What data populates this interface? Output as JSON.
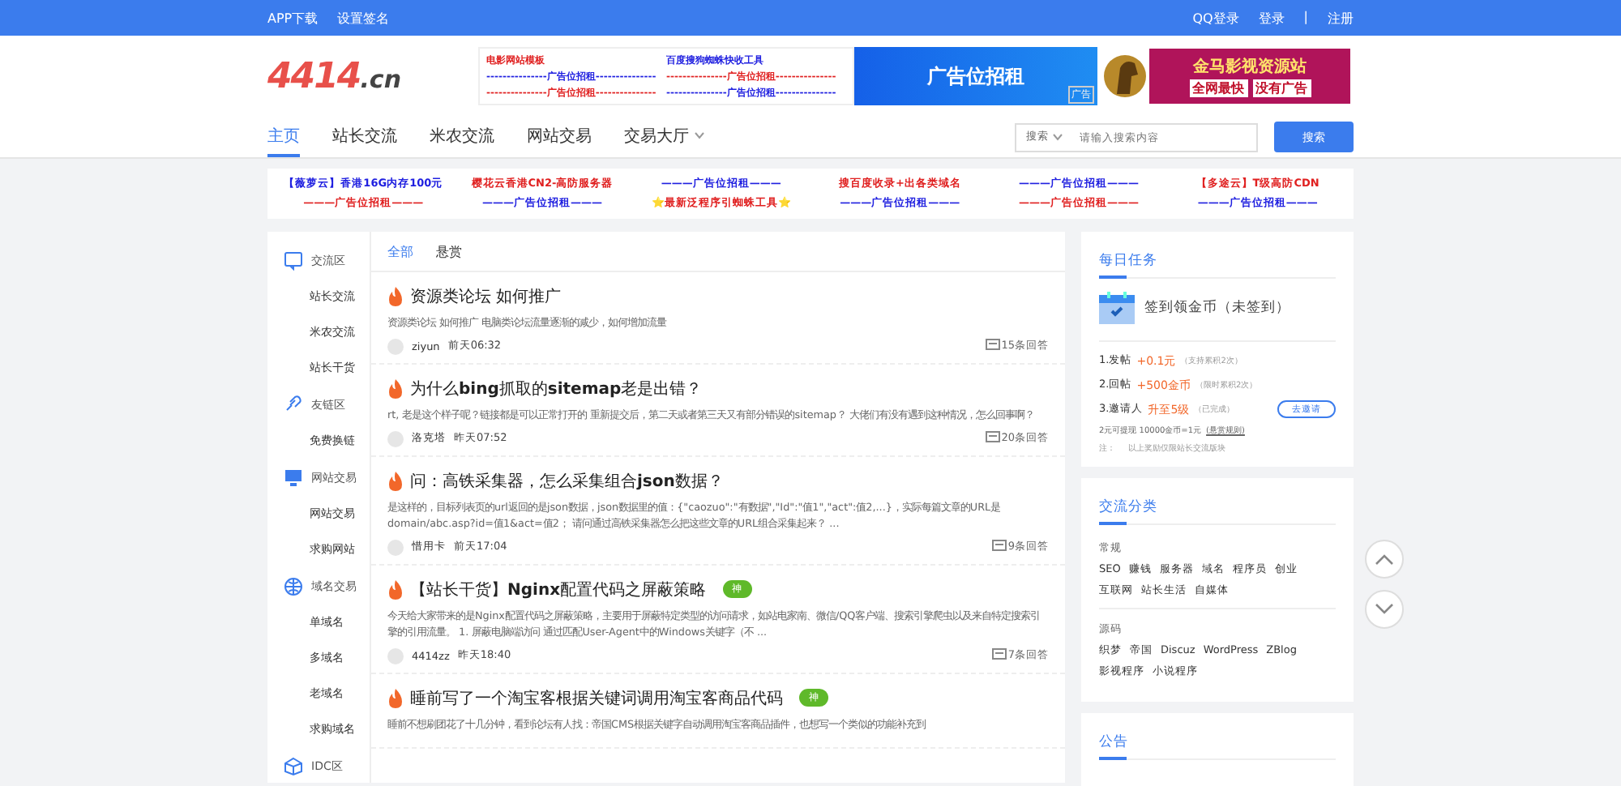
{
  "top_bar": {
    "left_links": [
      "APP下载",
      "设置签名"
    ],
    "right_links": [
      "QQ登录",
      "登录",
      "|",
      "注册"
    ]
  },
  "header": {
    "logo": {
      "main": "4414",
      "suffix": ".cn"
    },
    "text_ads": [
      {
        "text": "电影网站模板",
        "color": "#e02020"
      },
      {
        "text": "百度搜狗蜘蛛快收工具",
        "color": "#2020e0"
      },
      {
        "text": "---------------广告位招租---------------",
        "color": "#2020e0"
      },
      {
        "text": "---------------广告位招租---------------",
        "color": "#e02020"
      },
      {
        "text": "---------------广告位招租---------------",
        "color": "#e02020"
      },
      {
        "text": "---------------广告位招租---------------",
        "color": "#2020e0"
      }
    ],
    "banner_ad": "广告位招租",
    "banner_tag": "广告",
    "promo_ad": {
      "line1": "金马影视资源站",
      "line2": [
        "全网最快",
        "没有广告"
      ]
    }
  },
  "nav": {
    "items": [
      {
        "label": "主页",
        "selected": true,
        "dropdown": false
      },
      {
        "label": "站长交流",
        "selected": false,
        "dropdown": false
      },
      {
        "label": "米农交流",
        "selected": false,
        "dropdown": false
      },
      {
        "label": "网站交易",
        "selected": false,
        "dropdown": false
      },
      {
        "label": "交易大厅",
        "selected": false,
        "dropdown": true
      }
    ],
    "search": {
      "scope": "搜索",
      "placeholder": "请输入搜索内容",
      "button": "搜索"
    }
  },
  "ad_strip": [
    {
      "text": "【薇萝云】香港**16G**内存**100元**",
      "color": "#2020e0"
    },
    {
      "text": "樱花云香港**CN2**-高防服务器",
      "color": "#e02020"
    },
    {
      "text": "———广告位招租———",
      "color": "#2020e0"
    },
    {
      "text": "搜百度收录+出各类域名",
      "color": "#e02020"
    },
    {
      "text": "———广告位招租———",
      "color": "#2020e0"
    },
    {
      "text": "【多途云】**T级高防CDN**",
      "color": "#e02020"
    },
    {
      "text": "———广告位招租———",
      "color": "#e02020"
    },
    {
      "text": "———广告位招租———",
      "color": "#2020e0"
    },
    {
      "text": "⭐最新泛程序引蜘蛛工具⭐",
      "color": "#e02020"
    },
    {
      "text": "———广告位招租———",
      "color": "#2020e0"
    },
    {
      "text": "———广告位招租———",
      "color": "#e02020"
    },
    {
      "text": "———广告位招租———",
      "color": "#2020e0"
    }
  ],
  "sidebar": [
    {
      "label": "交流区",
      "kind": "chat",
      "children": [
        {
          "label": "站长交流"
        },
        {
          "label": "米农交流"
        },
        {
          "label": "站长干货"
        }
      ]
    },
    {
      "label": "友链区",
      "kind": "link",
      "children": [
        {
          "label": "免费换链"
        }
      ]
    },
    {
      "label": "网站交易",
      "kind": "monitor",
      "children": [
        {
          "label": "网站交易"
        },
        {
          "label": "求购网站"
        }
      ]
    },
    {
      "label": "域名交易",
      "kind": "globe",
      "children": [
        {
          "label": "单域名"
        },
        {
          "label": "多域名"
        },
        {
          "label": "老域名"
        },
        {
          "label": "求购域名"
        }
      ]
    },
    {
      "label": "IDC区",
      "kind": "cube"
    }
  ],
  "feed": {
    "tabs": [
      {
        "label": "全部",
        "selected": true
      },
      {
        "label": "悬赏",
        "selected": false
      }
    ],
    "posts": [
      {
        "title": "资源类论坛 如何推广",
        "summary": "资源类论坛 如何推广 电脑类论坛流量逐渐的减少，如何增加流量",
        "author": "ziyun",
        "time": "前天06:32",
        "replies": "15条回答"
      },
      {
        "title": "为什么**bing**抓取的**sitemap**老是出错？",
        "summary": "rt, 老是这个样子呢？链接都是可以正常打开的 重新提交后，第二天或者第三天又有部分错误的sitemap？ 大佬们有没有遇到这种情况，怎么回事啊？",
        "author": "洛克塔",
        "time": "昨天07:52",
        "replies": "20条回答"
      },
      {
        "title": "问：高铁采集器，怎么采集组合**json**数据？",
        "summary": "是这样的，目标列表页的url返回的是json数据，json数据里的值：{\"caozuo\":\"有数据\",\"Id\":\"值1\",\"act\":值2,...}，实际每篇文章的URL是 domain/abc.asp?id=值1&act=值2； 请问通过高铁采集器怎么把这些文章的URL组合采集起来？ ...",
        "author": "惜用卡",
        "time": "前天17:04",
        "replies": "9条回答"
      },
      {
        "title": "【站长干货】**Nginx**配置代码之屏蔽策略",
        "badge": "神",
        "summary": "今天给大家带来的是Nginx配置代码之屏蔽策略，主要用于屏蔽特定类型的访问请求，如站电家南、微信/QQ客户端、搜索引擎爬虫以及来自特定搜索引擎的引用流量。 1. 屏蔽电脑端访问 通过匹配User-Agent中的Windows关键字（不 ...",
        "author": "4414zz",
        "time": "昨天18:40",
        "replies": "7条回答"
      },
      {
        "title": "睡前写了一个淘宝客根据关键词调用淘宝客商品代码",
        "badge": "神",
        "summary": "睡前不想刷团花了十几分钟，看到论坛有人找：帝国CMS根据关键字自动调用淘宝客商品插件，也想写一个类似的功能补充到"
      }
    ]
  },
  "daily_tasks": {
    "title": "每日任务",
    "checkin": "签到领金币（未签到）",
    "tasks": [
      {
        "label": "1.发帖",
        "reward": "+0.1元",
        "note": "（支持累积2次）"
      },
      {
        "label": "2.回帖",
        "reward": "+500金币",
        "note": "（限时累积2次）"
      },
      {
        "label": "3.邀请人",
        "reward": "升至5级",
        "note": "（已完成）",
        "action": "去邀请"
      }
    ],
    "rule": "2元可提现 10000金币=1元",
    "rule_link": "(悬赏规则)",
    "note_label": "注：",
    "note": "以上奖励仅限站长交流版块"
  },
  "categories": {
    "title": "交流分类",
    "groups": [
      {
        "label": "常规",
        "tags": [
          "SEO",
          "赚钱",
          "服务器",
          "域名",
          "程序员",
          "创业",
          "互联网",
          "站长生活",
          "自媒体"
        ]
      },
      {
        "label": "源码",
        "tags": [
          "织梦",
          "帝国",
          "Discuz",
          "WordPress",
          "ZBlog",
          "影视程序",
          "小说程序"
        ]
      }
    ]
  },
  "notice": {
    "title": "公告"
  }
}
